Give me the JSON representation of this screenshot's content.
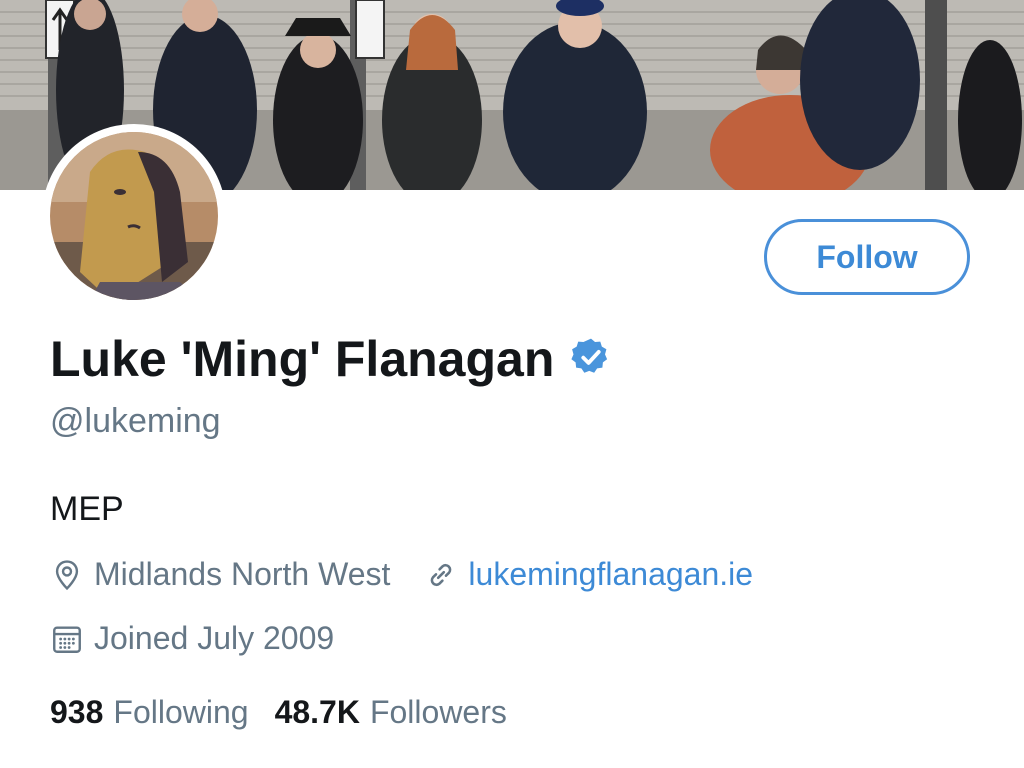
{
  "profile": {
    "display_name": "Luke 'Ming' Flanagan",
    "handle": "@lukeming",
    "verified": true,
    "bio": "MEP",
    "location": "Midlands North West",
    "website": "lukemingflanagan.ie",
    "joined": "Joined July 2009"
  },
  "actions": {
    "follow_label": "Follow"
  },
  "stats": {
    "following_count": "938",
    "following_label": "Following",
    "followers_count": "48.7K",
    "followers_label": "Followers"
  },
  "icons": {
    "verified": "verified-badge-icon",
    "location": "location-pin-icon",
    "link": "link-icon",
    "calendar": "calendar-icon"
  },
  "colors": {
    "accent": "#1da1f2",
    "text_primary": "#14171a",
    "text_secondary": "#657786",
    "link": "#3d8ad6"
  }
}
